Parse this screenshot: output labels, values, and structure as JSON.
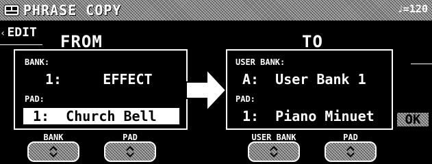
{
  "header": {
    "title": "PHRASE COPY",
    "tempo": "♩=120"
  },
  "edit_label": "EDIT",
  "from": {
    "heading": "FROM",
    "bank_label": "BANK:",
    "bank_value": "1:     EFFECT",
    "pad_label": "PAD:",
    "pad_value": "1:  Church Bell"
  },
  "to": {
    "heading": "TO",
    "bank_label": "USER BANK:",
    "bank_value": "A:  User Bank 1",
    "pad_label": "PAD:",
    "pad_value": "1:  Piano Minuet"
  },
  "ok_label": "OK",
  "knobs": [
    {
      "label": "BANK"
    },
    {
      "label": "PAD"
    },
    {
      "label": "USER BANK"
    },
    {
      "label": "PAD"
    }
  ]
}
